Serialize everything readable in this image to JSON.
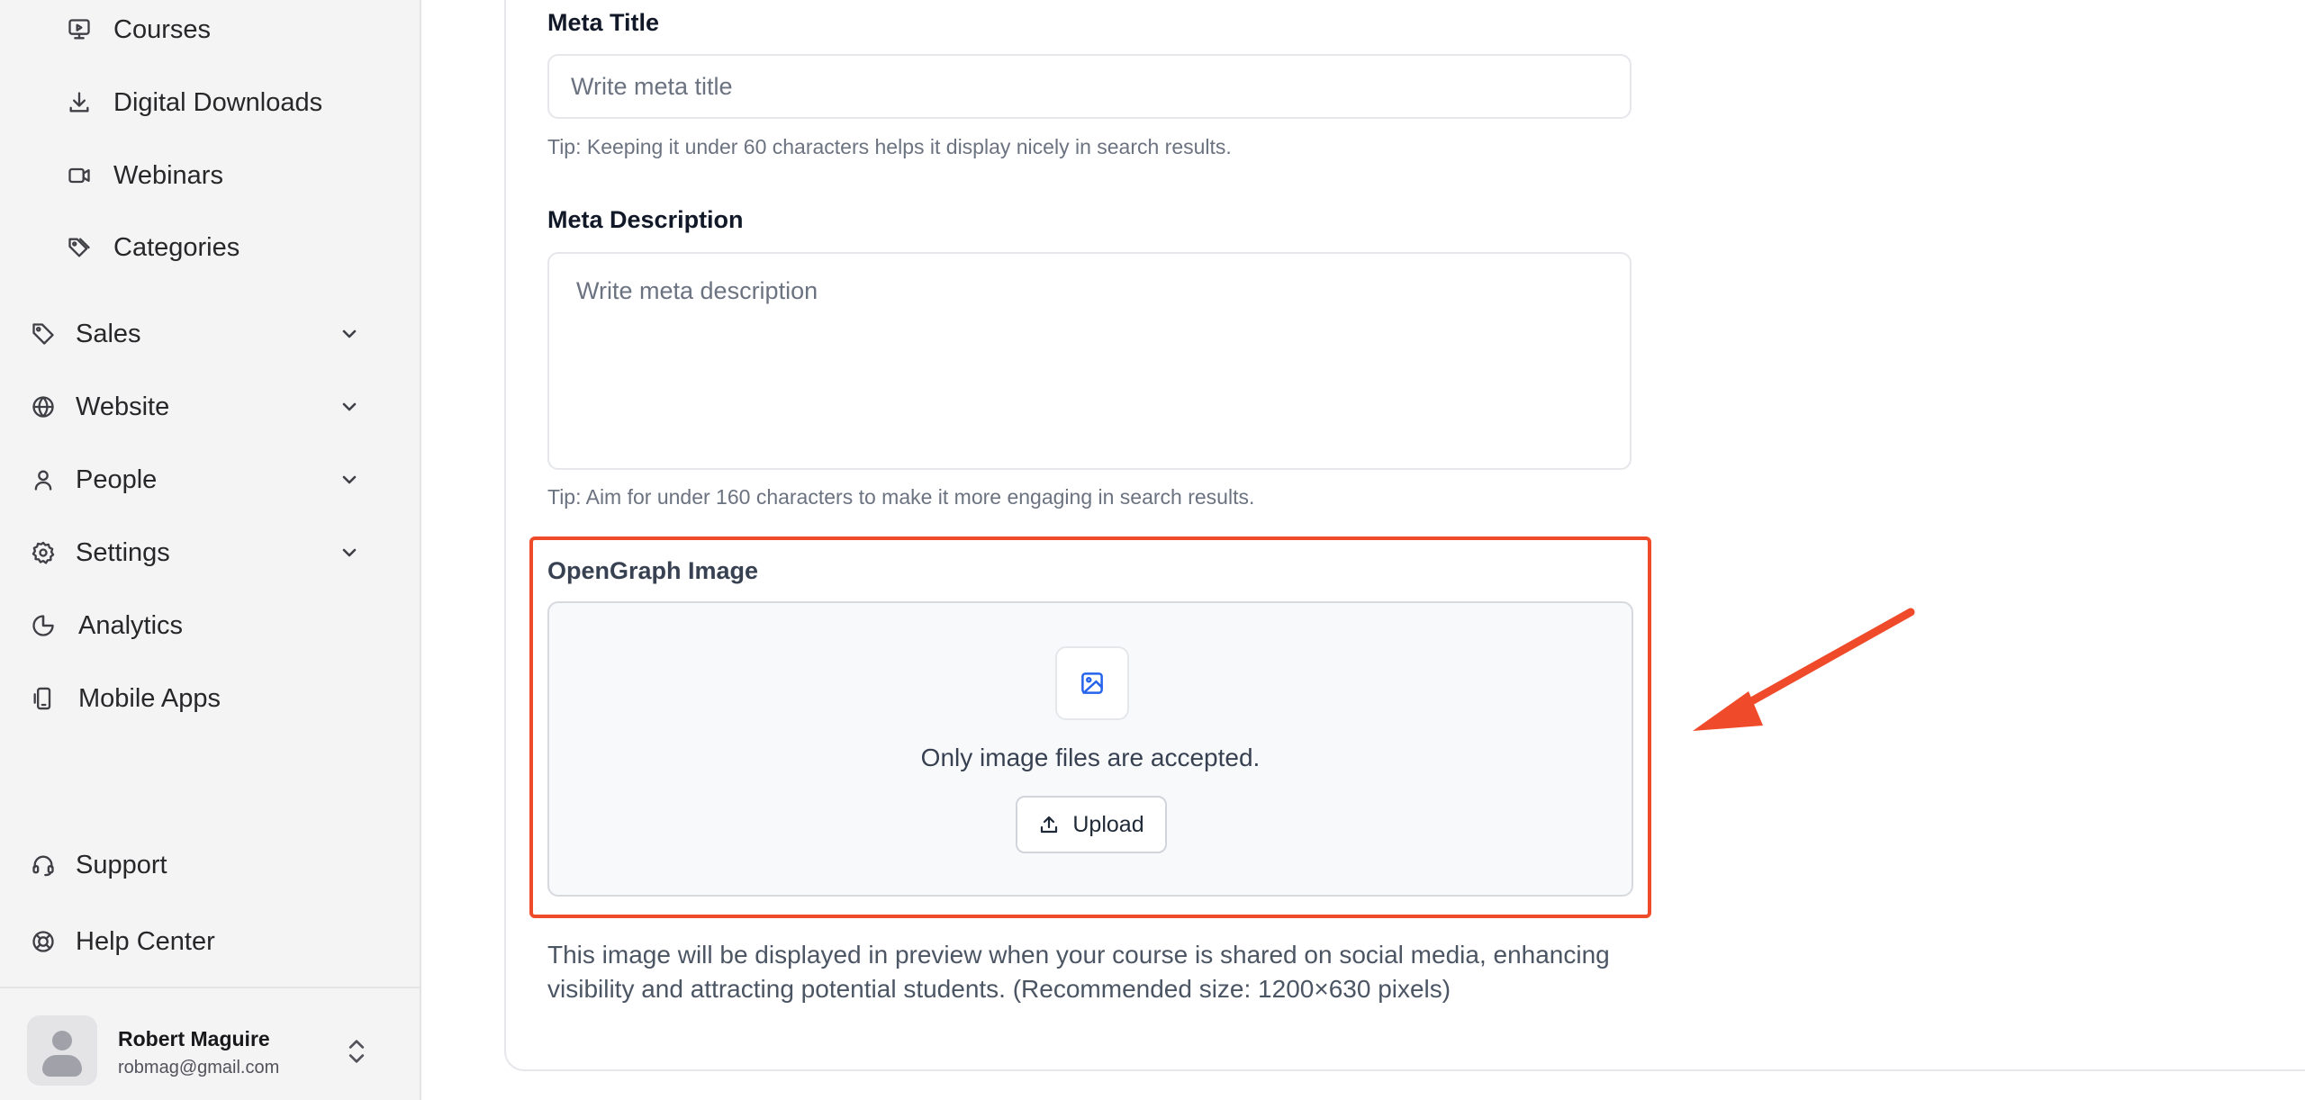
{
  "sidebar": {
    "sub_items": [
      {
        "label": "Courses",
        "icon": "presentation-play-icon"
      },
      {
        "label": "Digital Downloads",
        "icon": "download-icon"
      },
      {
        "label": "Webinars",
        "icon": "video-camera-icon"
      },
      {
        "label": "Categories",
        "icon": "tags-icon"
      }
    ],
    "items": [
      {
        "label": "Sales",
        "icon": "tag-icon",
        "expandable": true
      },
      {
        "label": "Website",
        "icon": "globe-icon",
        "expandable": true
      },
      {
        "label": "People",
        "icon": "user-icon",
        "expandable": true
      },
      {
        "label": "Settings",
        "icon": "gear-icon",
        "expandable": true
      },
      {
        "label": "Analytics",
        "icon": "pie-chart-icon",
        "expandable": false
      },
      {
        "label": "Mobile Apps",
        "icon": "mobile-icon",
        "expandable": false
      }
    ],
    "footer_items": [
      {
        "label": "Support",
        "icon": "headset-icon"
      },
      {
        "label": "Help Center",
        "icon": "lifebuoy-icon"
      }
    ],
    "user": {
      "name": "Robert Maguire",
      "email": "robmag@gmail.com"
    }
  },
  "form": {
    "meta_title": {
      "label": "Meta Title",
      "placeholder": "Write meta title",
      "value": "",
      "tip": "Tip: Keeping it under 60 characters helps it display nicely in search results."
    },
    "meta_description": {
      "label": "Meta Description",
      "placeholder": "Write meta description",
      "value": "",
      "tip": "Tip: Aim for under 160 characters to make it more engaging in search results."
    },
    "og_image": {
      "label": "OpenGraph Image",
      "accepted_text": "Only image files are accepted.",
      "upload_label": "Upload",
      "description": "This image will be displayed in preview when your course is shared on social media, enhancing visibility and attracting potential students. (Recommended size: 1200×630 pixels)"
    }
  },
  "annotation": {
    "highlight_color": "#ef4b2a",
    "arrow_color": "#ef4b2a"
  }
}
